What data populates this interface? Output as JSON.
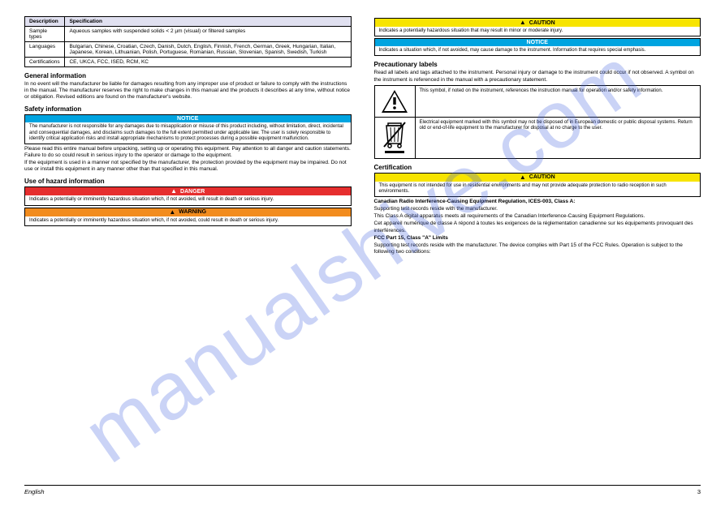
{
  "watermark": "manualshive.com",
  "left": {
    "spec": {
      "headers": [
        "Description",
        "Specification"
      ],
      "rows": [
        [
          "Sample types",
          "Aqueous samples with suspended solids < 2 µm (visual) or filtered samples"
        ],
        [
          "Languages",
          "Bulgarian, Chinese, Croatian, Czech, Danish, Dutch, English, Finnish, French, German, Greek, Hungarian, Italian, Japanese, Korean, Lithuanian, Polish, Portuguese, Romanian, Russian, Slovenian, Spanish, Swedish, Turkish"
        ],
        [
          "Certifications",
          "CE, UKCA, FCC, ISED, RCM, KC"
        ]
      ]
    },
    "general": {
      "title": "General information",
      "para": "In no event will the manufacturer be liable for damages resulting from any improper use of product or failure to comply with the instructions in the manual. The manufacturer reserves the right to make changes in this manual and the products it describes at any time, without notice or obligation. Revised editions are found on the manufacturer's website."
    },
    "safety": {
      "title": "Safety information",
      "notice": "NOTICE",
      "notice_body": "The manufacturer is not responsible for any damages due to misapplication or misuse of this product including, without limitation, direct, incidental and consequential damages, and disclaims such damages to the full extent permitted under applicable law. The user is solely responsible to identify critical application risks and install appropriate mechanisms to protect processes during a possible equipment malfunction.",
      "para1": "Please read this entire manual before unpacking, setting up or operating this equipment. Pay attention to all danger and caution statements. Failure to do so could result in serious injury to the operator or damage to the equipment.",
      "para2": "If the equipment is used in a manner not specified by the manufacturer, the protection provided by the equipment may be impaired. Do not use or install this equipment in any manner other than that specified in this manual."
    },
    "hazardinfo": {
      "title": "Use of hazard information",
      "danger_head": "DANGER",
      "danger_body": "Indicates a potentially or imminently hazardous situation which, if not avoided, will result in death or serious injury.",
      "warning_head": "WARNING",
      "warning_body": "Indicates a potentially or imminently hazardous situation which, if not avoided, could result in death or serious injury."
    }
  },
  "right": {
    "caution_head": "CAUTION",
    "caution_body": "Indicates a potentially hazardous situation that may result in minor or moderate injury.",
    "notice_head": "NOTICE",
    "notice_body": "Indicates a situation which, if not avoided, may cause damage to the instrument. Information that requires special emphasis.",
    "labels": {
      "title": "Precautionary labels",
      "para": "Read all labels and tags attached to the instrument. Personal injury or damage to the instrument could occur if not observed. A symbol on the instrument is referenced in the manual with a precautionary statement.",
      "row1": "This symbol, if noted on the instrument, references the instruction manual for operation and/or safety information.",
      "row2": "Electrical equipment marked with this symbol may not be disposed of in European domestic or public disposal systems. Return old or end-of-life equipment to the manufacturer for disposal at no charge to the user."
    },
    "cert": {
      "title": "Certification",
      "caution_head": "CAUTION",
      "caution_body": "This equipment is not intended for use in residential environments and may not provide adequate protection to radio reception in such environments.",
      "p_can_bold": "Canadian Radio Interference-Causing Equipment Regulation, ICES-003, Class A:",
      "p_can_1": "Supporting test records reside with the manufacturer.",
      "p_can_2": "This Class A digital apparatus meets all requirements of the Canadian Interference-Causing Equipment Regulations.",
      "p_can_3": "Cet appareil numérique de classe A répond à toutes les exigences de la réglementation canadienne sur les équipements provoquant des interférences.",
      "p_fcc_bold": "FCC Part 15, Class \"A\" Limits",
      "p_fcc_1": "Supporting test records reside with the manufacturer. The device complies with Part 15 of the FCC Rules. Operation is subject to the following two conditions:"
    }
  },
  "footer": {
    "left": "English",
    "right": "3"
  }
}
